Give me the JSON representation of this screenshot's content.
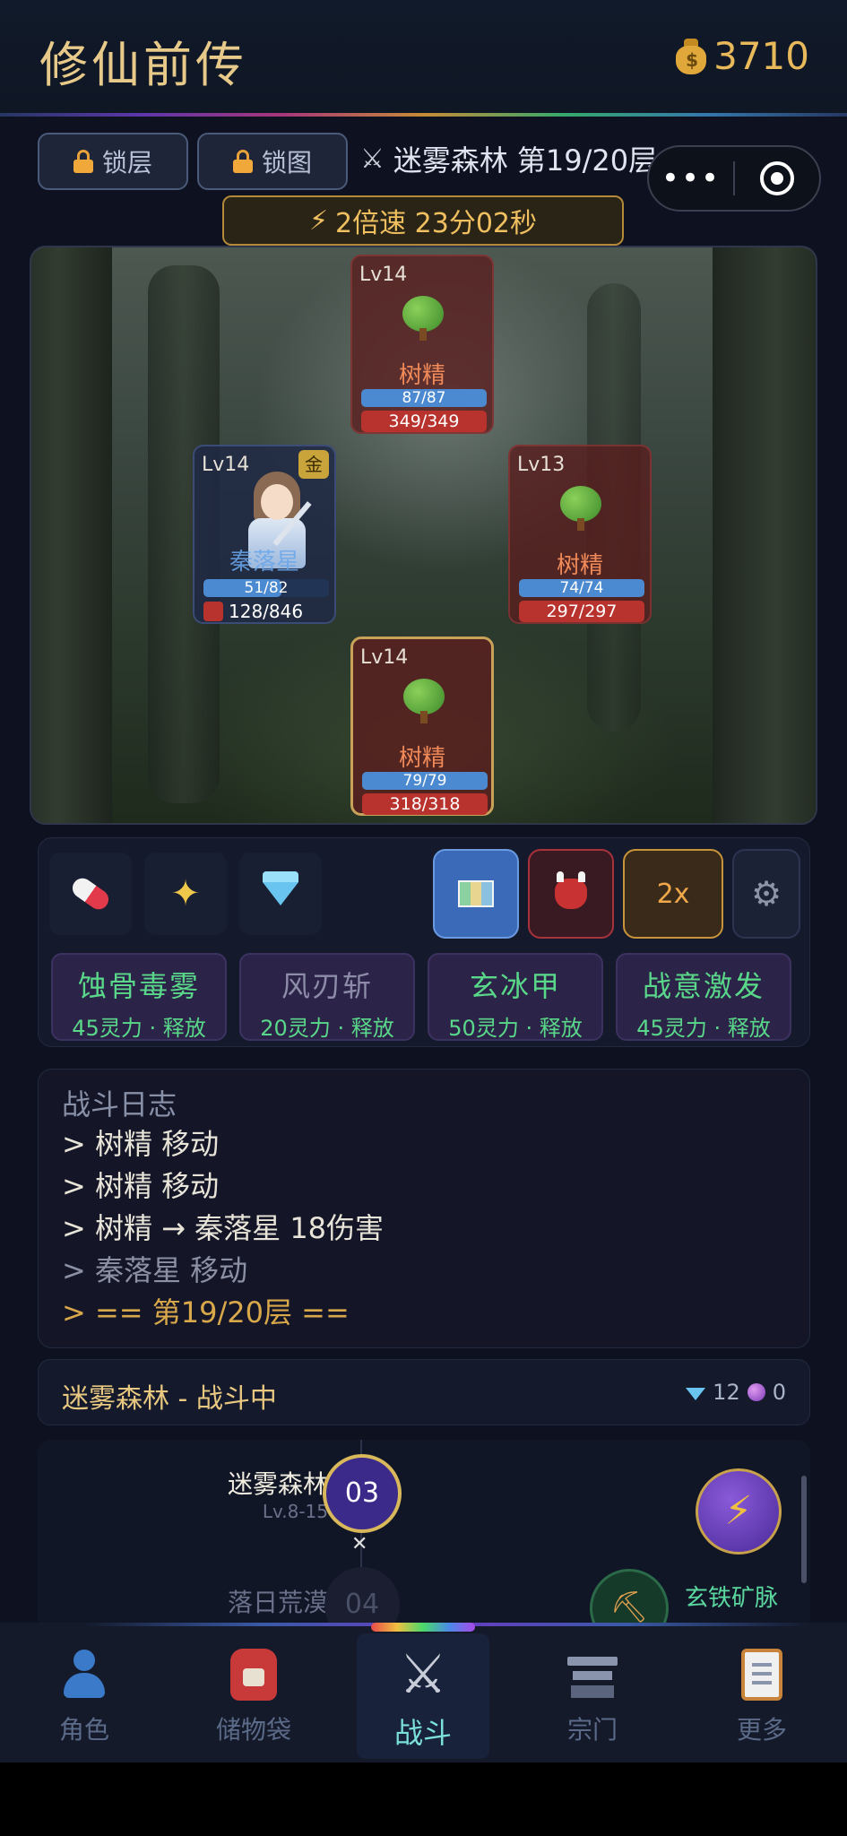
{
  "header": {
    "title": "修仙前传",
    "coins": "3710"
  },
  "locks": [
    {
      "label": "锁层"
    },
    {
      "label": "锁图"
    }
  ],
  "stage": {
    "zone": "迷雾森林",
    "floor": "第19/20层"
  },
  "speed_banner": {
    "text": "2倍速 23分02秒"
  },
  "battle": {
    "enemies": [
      {
        "level": "Lv14",
        "name": "树精",
        "mp": "87/87",
        "hp": "349/349"
      },
      {
        "level": "Lv13",
        "name": "树精",
        "mp": "74/74",
        "hp": "297/297"
      },
      {
        "level": "Lv14",
        "name": "树精",
        "mp": "79/79",
        "hp": "318/318"
      }
    ],
    "hero": {
      "level": "Lv14",
      "badge": "金",
      "name": "秦落星",
      "mp": "51/82",
      "mp_ratio": 0.62,
      "hp": "128/846"
    }
  },
  "toolbar": {
    "speed_label": "2x"
  },
  "skills": [
    {
      "name": "蚀骨毒雾",
      "cost": "45灵力 · 释放",
      "ready": true
    },
    {
      "name": "风刃斩",
      "cost": "20灵力 · 释放",
      "ready": false
    },
    {
      "name": "玄冰甲",
      "cost": "50灵力 · 释放",
      "ready": true
    },
    {
      "name": "战意激发",
      "cost": "45灵力 · 释放",
      "ready": true
    }
  ],
  "log": {
    "title": "战斗日志",
    "lines": [
      {
        "text": "> 树精 移动",
        "color": "#e8e4d8"
      },
      {
        "text": "> 树精 移动",
        "color": "#e8e4d8"
      },
      {
        "text": "> 树精 → 秦落星 18伤害",
        "color": "#e8e4d8"
      },
      {
        "text": "> 秦落星 移动",
        "color": "#8c90a4"
      },
      {
        "text": "> == 第19/20层 ==",
        "color": "#d8a84a"
      }
    ]
  },
  "status": {
    "text": "迷雾森林 - 战斗中",
    "gems": "12",
    "orbs": "0"
  },
  "map": {
    "current": {
      "name": "迷雾森林",
      "level": "Lv.8-15",
      "node": "03"
    },
    "next": {
      "name": "落日荒漠",
      "node": "04"
    },
    "mine_label": "玄铁矿脉"
  },
  "nav": [
    {
      "label": "角色",
      "active": false
    },
    {
      "label": "储物袋",
      "active": false
    },
    {
      "label": "战斗",
      "active": true
    },
    {
      "label": "宗门",
      "active": false
    },
    {
      "label": "更多",
      "active": false
    }
  ]
}
